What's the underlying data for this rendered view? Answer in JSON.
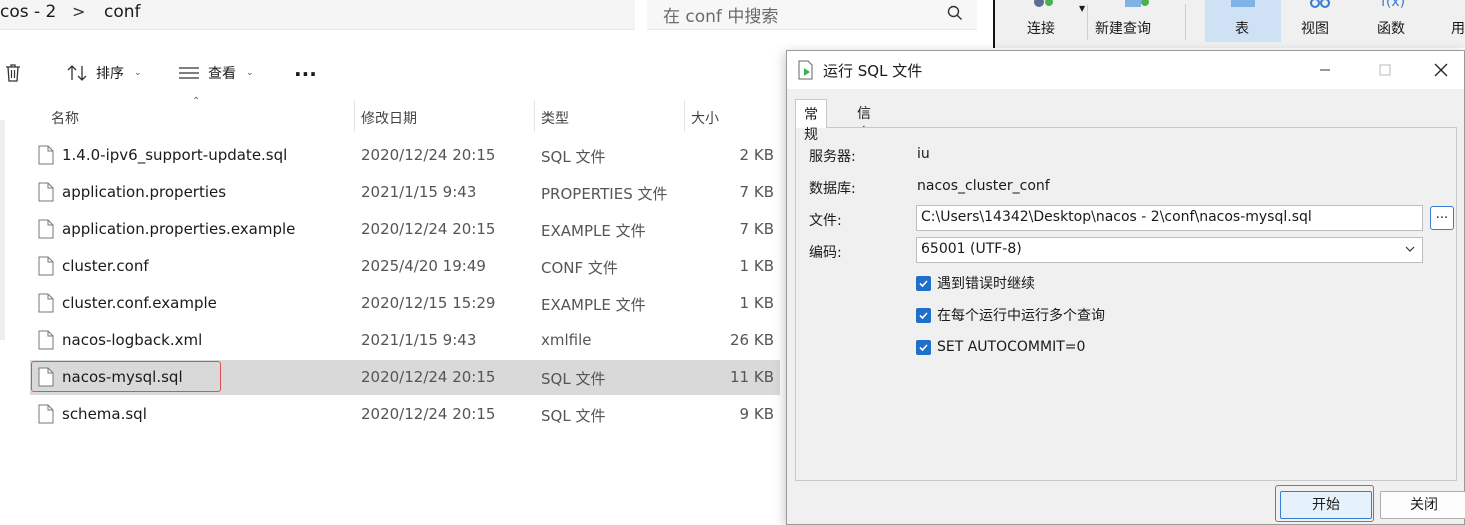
{
  "explorer": {
    "breadcrumb": {
      "parent": "cos - 2",
      "separator": ">",
      "current": "conf"
    },
    "search": {
      "placeholder": "在 conf 中搜索"
    },
    "toolbar": {
      "sort_label": "排序",
      "view_label": "查看",
      "more_label": "..."
    },
    "columns": {
      "name": "名称",
      "date": "修改日期",
      "type": "类型",
      "size": "大小"
    },
    "files": [
      {
        "name": "1.4.0-ipv6_support-update.sql",
        "date": "2020/12/24 20:15",
        "type": "SQL 文件",
        "size": "2 KB"
      },
      {
        "name": "application.properties",
        "date": "2021/1/15 9:43",
        "type": "PROPERTIES 文件",
        "size": "7 KB"
      },
      {
        "name": "application.properties.example",
        "date": "2020/12/24 20:15",
        "type": "EXAMPLE 文件",
        "size": "7 KB"
      },
      {
        "name": "cluster.conf",
        "date": "2025/4/20 19:49",
        "type": "CONF 文件",
        "size": "1 KB"
      },
      {
        "name": "cluster.conf.example",
        "date": "2020/12/15 15:29",
        "type": "EXAMPLE 文件",
        "size": "1 KB"
      },
      {
        "name": "nacos-logback.xml",
        "date": "2021/1/15 9:43",
        "type": "xmlfile",
        "size": "26 KB"
      },
      {
        "name": "nacos-mysql.sql",
        "date": "2020/12/24 20:15",
        "type": "SQL 文件",
        "size": "11 KB"
      },
      {
        "name": "schema.sql",
        "date": "2020/12/24 20:15",
        "type": "SQL 文件",
        "size": "9 KB"
      }
    ]
  },
  "ribbon": {
    "connect": "连接",
    "new_query": "新建查询",
    "table": "表",
    "view": "视图",
    "function": "函数",
    "more": "用"
  },
  "dialog": {
    "title": "运行 SQL 文件",
    "tabs": {
      "general": "常规",
      "log": "信息日志"
    },
    "server_label": "服务器:",
    "server_value": "iu",
    "database_label": "数据库:",
    "database_value": "nacos_cluster_conf",
    "file_label": "文件:",
    "file_value": "C:\\Users\\14342\\Desktop\\nacos - 2\\conf\\nacos-mysql.sql",
    "browse_label": "...",
    "encoding_label": "编码:",
    "encoding_value": "65001 (UTF-8)",
    "options": [
      {
        "label": "遇到错误时继续",
        "checked": true
      },
      {
        "label": "在每个运行中运行多个查询",
        "checked": true
      },
      {
        "label": "SET AUTOCOMMIT=0",
        "checked": true
      }
    ],
    "start_button": "开始",
    "close_button": "关闭"
  },
  "colors": {
    "accent": "#1f6fcc",
    "highlight": "#e05050",
    "selected_row": "#d9d9d9"
  }
}
